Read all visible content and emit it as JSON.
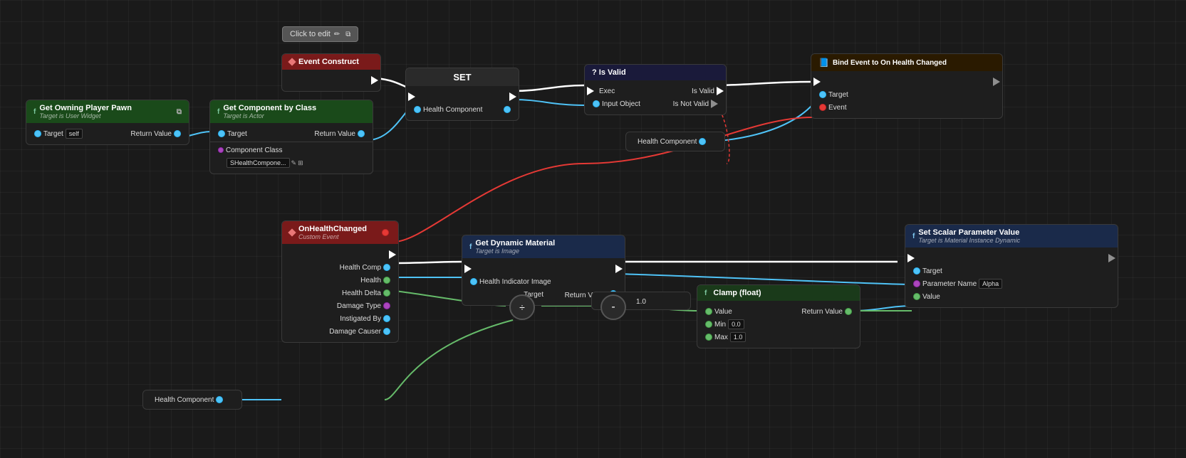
{
  "nodes": {
    "click_to_edit": {
      "label": "Click to edit",
      "icon": "edit"
    },
    "event_construct": {
      "header": "Event Construct",
      "type": "event"
    },
    "get_owning_player_pawn": {
      "header": "Get Owning Player Pawn",
      "subtitle": "Target is User Widget",
      "target_label": "Target",
      "target_value": "self",
      "return_label": "Return Value"
    },
    "get_component_by_class": {
      "header": "Get Component by Class",
      "subtitle": "Target is Actor",
      "target_label": "Target",
      "component_class_label": "Component Class",
      "component_class_value": "SHealthCompone...",
      "return_label": "Return Value"
    },
    "set_node": {
      "header": "SET",
      "health_component_label": "Health Component"
    },
    "is_valid": {
      "header": "? Is Valid",
      "exec_label": "Exec",
      "is_valid_label": "Is Valid",
      "input_object_label": "Input Object",
      "is_not_valid_label": "Is Not Valid"
    },
    "health_component_ref1": {
      "label": "Health Component"
    },
    "bind_event": {
      "header": "Bind Event to On Health Changed",
      "target_label": "Target",
      "event_label": "Event"
    },
    "on_health_changed": {
      "header": "OnHealthChanged",
      "subtitle": "Custom Event",
      "health_comp_label": "Health Comp",
      "health_label": "Health",
      "health_delta_label": "Health Delta",
      "damage_type_label": "Damage Type",
      "instigated_by_label": "Instigated By",
      "damage_causer_label": "Damage Causer"
    },
    "health_component_ref2": {
      "label": "Health Component"
    },
    "get_dynamic_material": {
      "header": "Get Dynamic Material",
      "subtitle": "Target is Image",
      "health_indicator_label": "Health Indicator Image",
      "target_label": "Target",
      "return_label": "Return Value"
    },
    "clamp_float": {
      "header": "Clamp (float)",
      "value_label": "Value",
      "min_label": "Min",
      "min_value": "0.0",
      "max_label": "Max",
      "max_value": "1.0",
      "return_label": "Return Value"
    },
    "set_scalar_param": {
      "header": "Set Scalar Parameter Value",
      "subtitle": "Target is Material Instance Dynamic",
      "target_label": "Target",
      "parameter_name_label": "Parameter Name",
      "parameter_name_value": "Alpha",
      "value_label": "Value"
    },
    "divide_op": {
      "symbol": "÷"
    },
    "minus_op": {
      "symbol": "-"
    },
    "const_1": {
      "value": "1.0"
    }
  }
}
